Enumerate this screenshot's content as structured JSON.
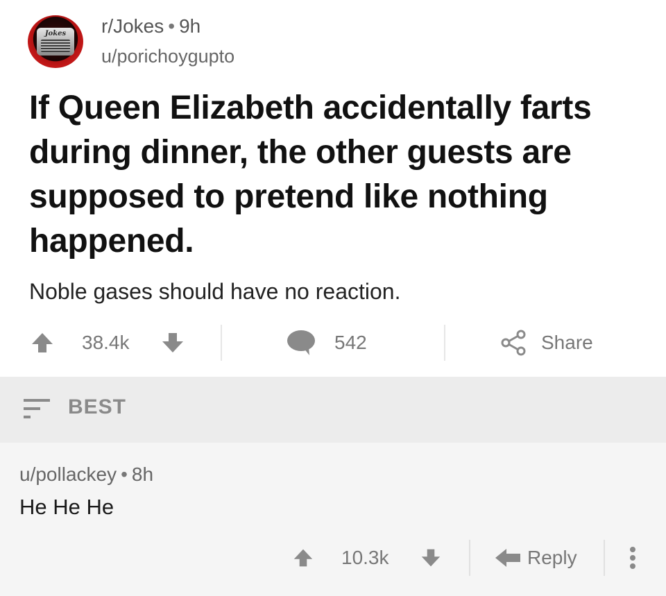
{
  "post": {
    "subreddit": "r/Jokes",
    "age": "9h",
    "author": "u/porichoygupto",
    "title": "If Queen Elizabeth accidentally farts during dinner, the other guests are supposed to pretend like nothing happened.",
    "body": "Noble gases should have no reaction.",
    "score": "38.4k",
    "comments": "542",
    "share_label": "Share",
    "avatar_text": "Jokes"
  },
  "sort": {
    "label": "BEST"
  },
  "comment": {
    "author": "u/pollackey",
    "age": "8h",
    "body": "He He He",
    "score": "10.3k",
    "reply_label": "Reply"
  },
  "colors": {
    "text_primary": "#111111",
    "text_muted": "#777777",
    "sortbar_bg": "#ececec",
    "comment_bg": "#f5f5f5",
    "avatar_red": "#c41818"
  },
  "icons": [
    "upvote-icon",
    "downvote-icon",
    "comment-bubble-icon",
    "share-icon",
    "sort-icon",
    "reply-arrow-icon",
    "more-vertical-icon"
  ]
}
